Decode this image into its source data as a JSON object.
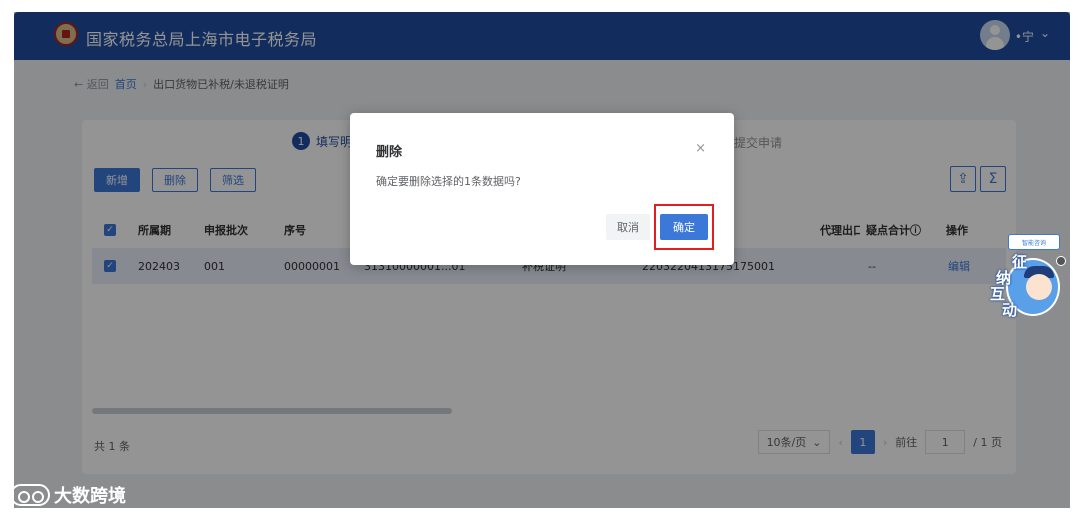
{
  "header": {
    "title": "国家税务总局上海市电子税务局",
    "user_name": "•宁",
    "user_chevron": "⌄"
  },
  "breadcrumb": {
    "back": "← 返回",
    "home": "首页",
    "separator": "›",
    "current": "出口货物已补税/未退税证明"
  },
  "steps": {
    "step1_num": "1",
    "step1_label": "填写明细",
    "step3_label": "提交申请"
  },
  "toolbar": {
    "add": "新增",
    "delete": "删除",
    "filter": "筛选",
    "export_icon": "⇪",
    "sum_icon": "Σ"
  },
  "table": {
    "headers": {
      "period": "所属期",
      "batch": "申报批次",
      "seq": "序号",
      "agent": "代理出口",
      "doubt": "疑点合计ⓘ",
      "action": "操作"
    },
    "row": {
      "period": "202403",
      "batch": "001",
      "seq": "00000001",
      "col4": "31310000001...01",
      "col5": "补税证明",
      "col6": "2203220413175175001",
      "doubt": "--",
      "action": "编辑"
    }
  },
  "footer": {
    "total": "共 1 条",
    "page_size": "10条/页",
    "page_num": "1",
    "goto_label": "前往",
    "goto_value": "1",
    "page_total": "/ 1 页"
  },
  "dialog": {
    "title": "删除",
    "close": "×",
    "message": "确定要删除选择的1条数据吗?",
    "cancel": "取消",
    "confirm": "确定"
  },
  "mascot": {
    "tag": "智能咨询",
    "text_line1": "征",
    "text_line2": "纳",
    "text_line3": "互",
    "text_line4": "动"
  },
  "watermark": {
    "text": "大数跨境"
  },
  "colors": {
    "header_bg": "#1f4fa1",
    "accent": "#3c78d8",
    "highlight_frame": "#e02020"
  }
}
